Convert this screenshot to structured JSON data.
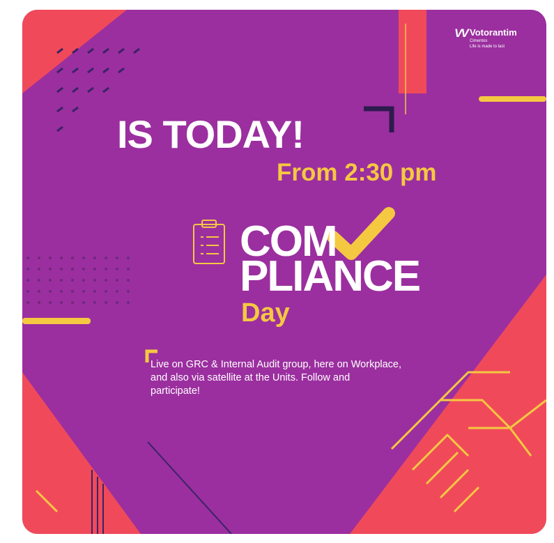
{
  "logo": {
    "icon": "votorantim-logo-icon",
    "name": "Votorantim",
    "subtitle": "Cimentos",
    "tagline": "Life is made to last"
  },
  "headline": "IS TODAY!",
  "time": "From 2:30 pm",
  "event": {
    "title_line1": "COM",
    "title_line2": "PLIANCE",
    "title_line3": "Day",
    "icons": [
      "clipboard-icon",
      "checkmark-icon",
      "handshake-icon"
    ]
  },
  "description": "Live on GRC & Internal Audit group, here on Workplace, and also via satellite at the Units. Follow and participate!",
  "colors": {
    "background": "#9b2f9f",
    "accent_red": "#f04a5a",
    "accent_yellow": "#f5c842",
    "text": "#ffffff",
    "dark_corner": "#2d1b4e"
  }
}
